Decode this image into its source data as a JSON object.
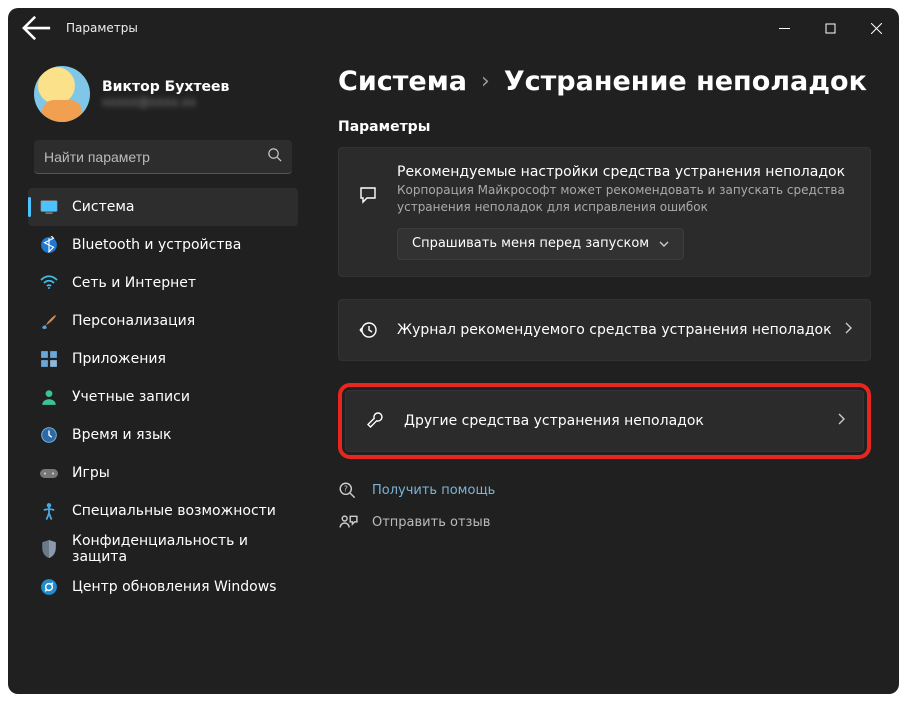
{
  "titlebar": {
    "title": "Параметры"
  },
  "profile": {
    "name": "Виктор Бухтеев",
    "email": "xxxxx@xxxx.xx"
  },
  "search": {
    "placeholder": "Найти параметр"
  },
  "sidebar": {
    "items": [
      {
        "label": "Система"
      },
      {
        "label": "Bluetooth и устройства"
      },
      {
        "label": "Сеть и Интернет"
      },
      {
        "label": "Персонализация"
      },
      {
        "label": "Приложения"
      },
      {
        "label": "Учетные записи"
      },
      {
        "label": "Время и язык"
      },
      {
        "label": "Игры"
      },
      {
        "label": "Специальные возможности"
      },
      {
        "label": "Конфиденциальность и защита"
      },
      {
        "label": "Центр обновления Windows"
      }
    ]
  },
  "breadcrumb": {
    "root": "Система",
    "current": "Устранение неполадок"
  },
  "main": {
    "section_label": "Параметры",
    "rec": {
      "title": "Рекомендуемые настройки средства устранения неполадок",
      "sub": "Корпорация Майкрософт может рекомендовать и запускать средства устранения неполадок для исправления ошибок",
      "dropdown": "Спрашивать меня перед запуском"
    },
    "rows": [
      {
        "label": "Журнал рекомендуемого средства устранения неполадок"
      },
      {
        "label": "Другие средства устранения неполадок"
      }
    ],
    "help": "Получить помощь",
    "feedback": "Отправить отзыв"
  }
}
